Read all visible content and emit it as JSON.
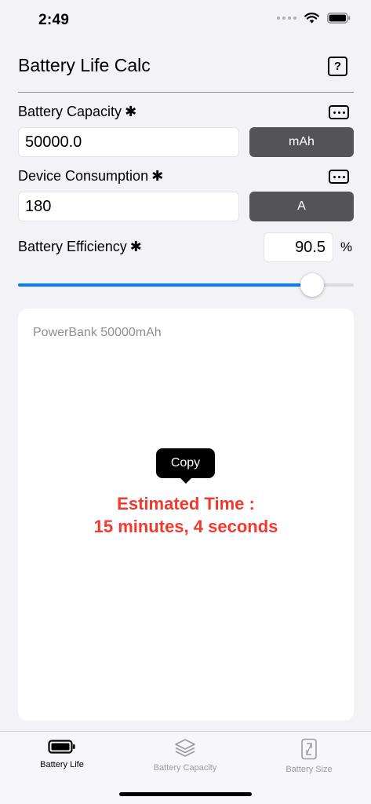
{
  "status_bar": {
    "time": "2:49"
  },
  "header": {
    "title": "Battery Life Calc",
    "help_label": "?"
  },
  "battery_capacity": {
    "label": "Battery Capacity",
    "required_mark": "✱",
    "value": "50000.0",
    "unit": "mAh"
  },
  "device_consumption": {
    "label": "Device Consumption",
    "required_mark": "✱",
    "value": "180",
    "unit": "A"
  },
  "battery_efficiency": {
    "label": "Battery Efficiency",
    "required_mark": "✱",
    "value": "90.5",
    "unit": "%",
    "slider_fraction": 0.905
  },
  "result": {
    "preset_name": "PowerBank 50000mAh",
    "copy_label": "Copy",
    "line1": "Estimated Time :",
    "line2": "15 minutes, 4 seconds"
  },
  "tabs": [
    {
      "label": "Battery Life",
      "icon": "battery-icon",
      "active": true
    },
    {
      "label": "Battery Capacity",
      "icon": "layers-icon",
      "active": false
    },
    {
      "label": "Battery Size",
      "icon": "resize-phone-icon",
      "active": false
    }
  ],
  "colors": {
    "accent": "#0a7aff",
    "result": "#f0392f",
    "unit_button": "#545456"
  }
}
